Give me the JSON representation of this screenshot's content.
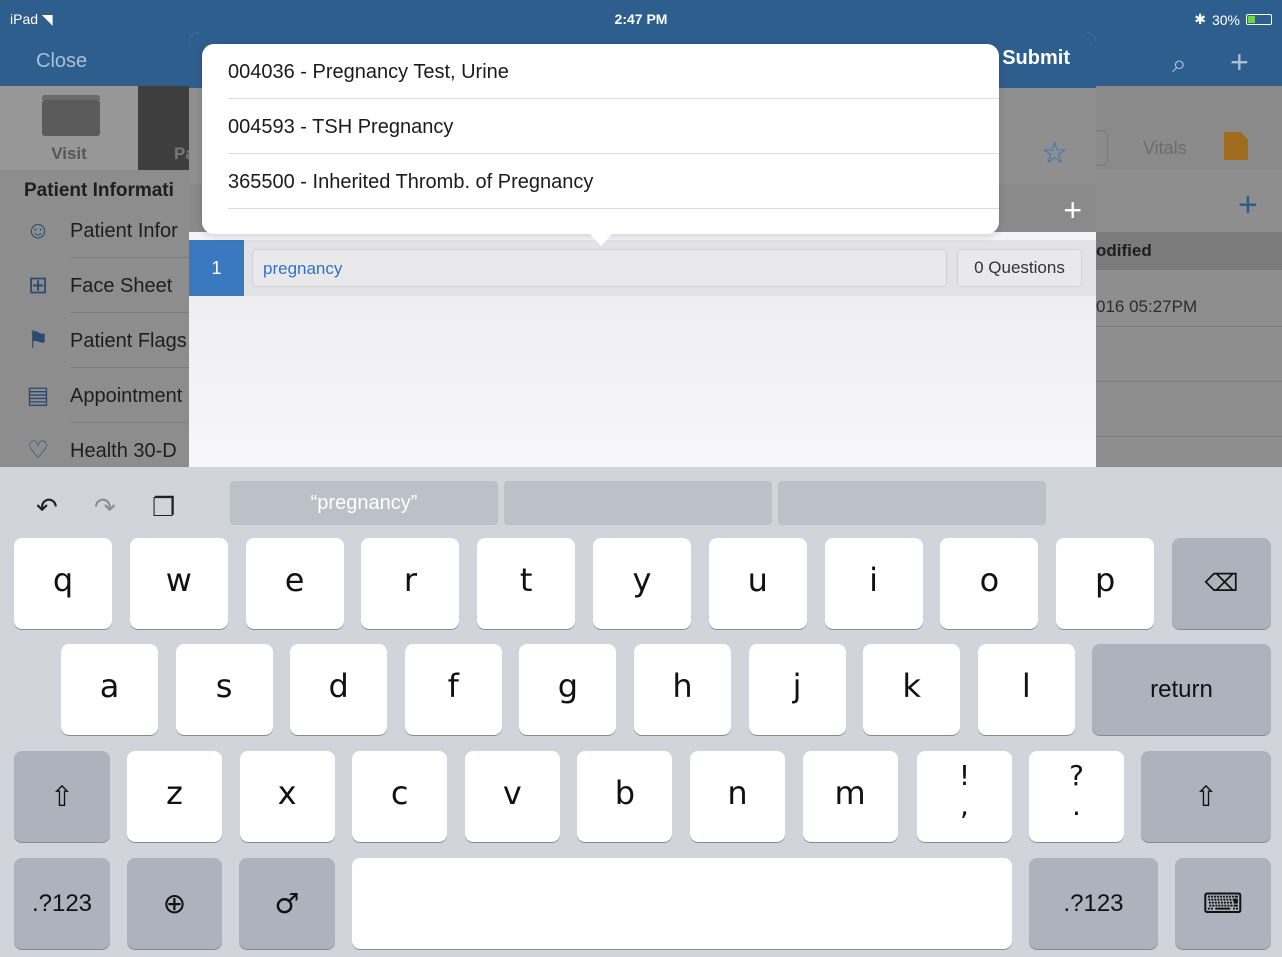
{
  "status_bar": {
    "device": "iPad",
    "wifi_icon": "wifi-icon",
    "time": "2:47 PM",
    "bluetooth_icon": "bluetooth-icon",
    "battery": "30%",
    "battery_level": 0.3
  },
  "nav": {
    "close_label": "Close",
    "search_icon": "search-icon",
    "add_icon": "plus-icon"
  },
  "tabs": {
    "visit_label": "Visit",
    "pa_label": "Pa",
    "vitals_label": "Vitals"
  },
  "sidebar": {
    "header": "Patient Informati",
    "items": [
      {
        "label": "Patient Infor",
        "icon": "person-icon"
      },
      {
        "label": "Face Sheet",
        "icon": "grid-icon"
      },
      {
        "label": "Patient Flags",
        "icon": "flag-icon"
      },
      {
        "label": "Appointment",
        "icon": "calendar-icon"
      },
      {
        "label": "Health 30-D",
        "icon": "heart-icon"
      }
    ]
  },
  "right_column": {
    "header": "odified",
    "date": "016 05:27PM"
  },
  "modal": {
    "submit_label": "Submit",
    "row_number": "1",
    "search_value": "pregnancy",
    "questions_label": "0 Questions"
  },
  "suggestions": [
    "004036 - Pregnancy Test, Urine",
    "004593 - TSH Pregnancy",
    "365500 - Inherited Thromb. of Pregnancy"
  ],
  "keyboard": {
    "prediction": "“pregnancy”",
    "row1": [
      "q",
      "w",
      "e",
      "r",
      "t",
      "y",
      "u",
      "i",
      "o",
      "p"
    ],
    "row2": [
      "a",
      "s",
      "d",
      "f",
      "g",
      "h",
      "j",
      "k",
      "l"
    ],
    "row3": [
      "z",
      "x",
      "c",
      "v",
      "b",
      "n",
      "m"
    ],
    "excl_top": "!",
    "excl_bottom": ",",
    "quest_top": "?",
    "quest_bottom": ".",
    "return_label": "return",
    "numbers_label": ".?123"
  }
}
